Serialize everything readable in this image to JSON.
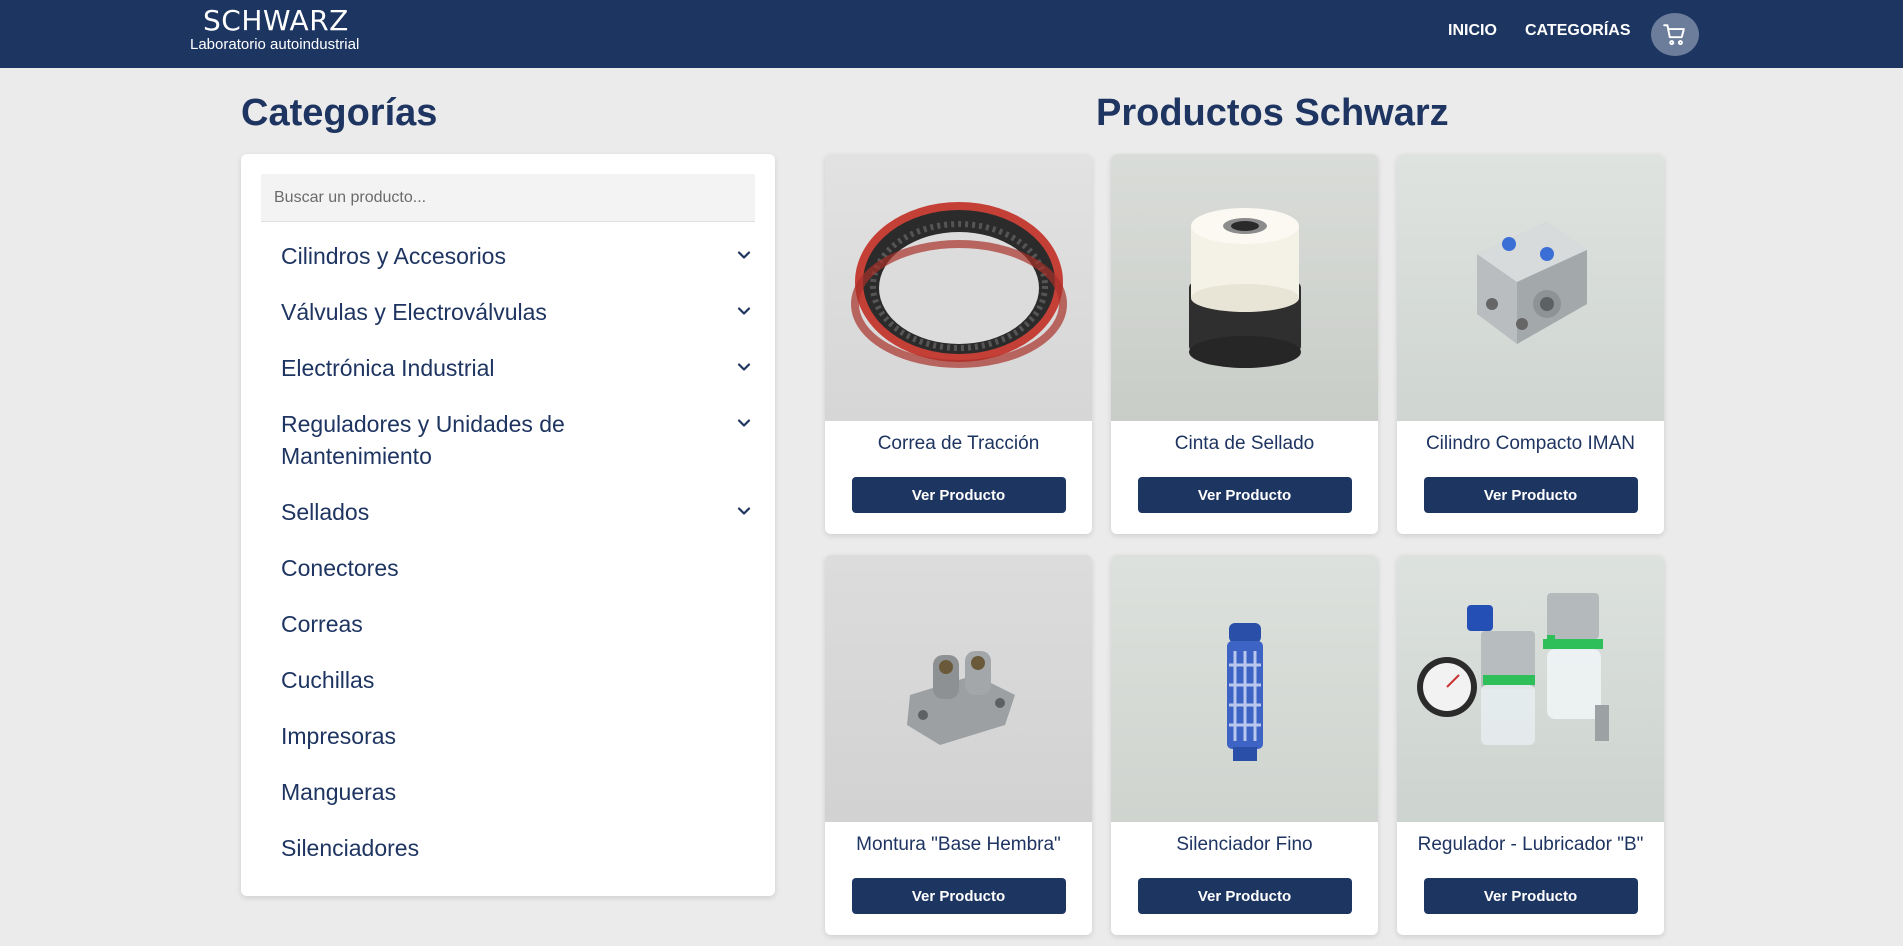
{
  "header": {
    "logo_main": "SCHWARZ",
    "logo_sub": "Laboratorio autoindustrial",
    "nav": [
      {
        "label": "INICIO"
      },
      {
        "label": "CATEGORÍAS"
      }
    ],
    "cart_icon": "cart-icon"
  },
  "sidebar": {
    "title": "Categorías",
    "search_placeholder": "Buscar un producto...",
    "categories": [
      {
        "label": "Cilindros y Accesorios",
        "expandable": true
      },
      {
        "label": "Válvulas y Electroválvulas",
        "expandable": true
      },
      {
        "label": "Electrónica Industrial",
        "expandable": true
      },
      {
        "label": "Reguladores y Unidades de Mantenimiento",
        "expandable": true
      },
      {
        "label": "Sellados",
        "expandable": true
      },
      {
        "label": "Conectores",
        "expandable": false
      },
      {
        "label": "Correas",
        "expandable": false
      },
      {
        "label": "Cuchillas",
        "expandable": false
      },
      {
        "label": "Impresoras",
        "expandable": false
      },
      {
        "label": "Mangueras",
        "expandable": false
      },
      {
        "label": "Silenciadores",
        "expandable": false
      }
    ]
  },
  "products": {
    "title": "Productos Schwarz",
    "button_label": "Ver Producto",
    "items": [
      {
        "name": "Correa de Tracción"
      },
      {
        "name": "Cinta de Sellado"
      },
      {
        "name": "Cilindro Compacto IMAN"
      },
      {
        "name": "Montura \"Base Hembra\""
      },
      {
        "name": "Silenciador Fino"
      },
      {
        "name": "Regulador - Lubricador \"B\""
      }
    ]
  },
  "colors": {
    "brand": "#1d3561",
    "background": "#ebebeb",
    "text": "#1e3461"
  }
}
